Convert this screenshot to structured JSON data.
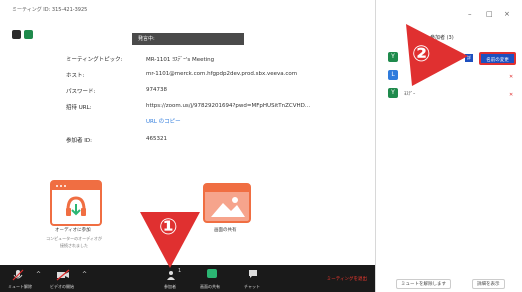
{
  "window": {
    "title": "ミーティング ID: 315-421-3925"
  },
  "badge": {
    "text": "発言中:"
  },
  "info": [
    {
      "label": "ミーティングトピック:",
      "value": "MR-1101 ﾖｽﾃﾞｰ's Meeting"
    },
    {
      "label": "ホスト:",
      "value": "mr-1101@merck.com.hfgpdp2dev.prod.sbx.veeva.com"
    },
    {
      "label": "パスワード:",
      "value": "974738"
    },
    {
      "label": "招待 URL:",
      "value": "https://zoom.us/j/97829201694?pwd=MFpHUSitTnZCVHD...",
      "extra": "URL のコピー"
    },
    {
      "label": "参加者 ID:",
      "value": "465321"
    }
  ],
  "cards": {
    "audio": {
      "label": "オーディオに参加",
      "sub1": "コンピューターのオーディオが",
      "sub2": "接続されました"
    },
    "share": {
      "label": "画面の共有"
    }
  },
  "toolbar": {
    "mute": "ミュート解除",
    "video": "ビデオの開始",
    "participants": "参加者",
    "participants_count": "1",
    "share": "画面の共有",
    "chat": "チャット",
    "end": "ミーティングを退出"
  },
  "side": {
    "title": "参加者 (3)",
    "participants": [
      {
        "initial": "Y",
        "name": "",
        "color": "#1f8a4c"
      },
      {
        "initial": "L",
        "name": "",
        "color": "#2f7bdc"
      },
      {
        "initial": "Y",
        "name": "ﾖｽﾃﾞｰ",
        "color": "#1f8a4c"
      }
    ],
    "more_label": "詳",
    "rename_label": "名前の変更",
    "mute_all": "ミュートを解除します",
    "more_options": "詳細を表示"
  },
  "callouts": {
    "one": "①",
    "two": "②"
  },
  "colors": {
    "accent": "#1d4fbf",
    "highlight": "#e03030",
    "toolbar": "#1a1a1a"
  }
}
